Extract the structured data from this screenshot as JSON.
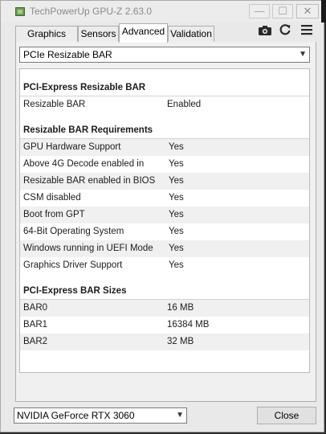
{
  "window": {
    "title": "TechPowerUp GPU-Z 2.63.0",
    "min_glyph": "—",
    "max_glyph": "☐",
    "close_glyph": "✕"
  },
  "tabs": [
    {
      "label": "Graphics Card",
      "active": false
    },
    {
      "label": "Sensors",
      "active": false
    },
    {
      "label": "Advanced",
      "active": true
    },
    {
      "label": "Validation",
      "active": false
    }
  ],
  "toolbar": {
    "icons": [
      "camera-icon",
      "refresh-icon",
      "menu-icon"
    ]
  },
  "category_select": {
    "value": "PCIe Resizable BAR"
  },
  "sections": [
    {
      "title": "PCI-Express Resizable BAR",
      "rows": [
        {
          "label": "Resizable BAR",
          "value": "Enabled"
        }
      ]
    },
    {
      "title": "Resizable BAR Requirements",
      "rows": [
        {
          "label": "GPU Hardware Support",
          "value": "Yes"
        },
        {
          "label": "Above 4G Decode enabled in",
          "value": "Yes"
        },
        {
          "label": "Resizable BAR enabled in BIOS",
          "value": "Yes"
        },
        {
          "label": "CSM disabled",
          "value": "Yes"
        },
        {
          "label": "Boot from GPT",
          "value": "Yes"
        },
        {
          "label": "64-Bit Operating System",
          "value": "Yes"
        },
        {
          "label": "Windows running in UEFI Mode",
          "value": "Yes"
        },
        {
          "label": "Graphics Driver Support",
          "value": "Yes"
        }
      ]
    },
    {
      "title": "PCI-Express BAR Sizes",
      "rows": [
        {
          "label": "BAR0",
          "value": "16 MB"
        },
        {
          "label": "BAR1",
          "value": "16384 MB"
        },
        {
          "label": "BAR2",
          "value": "32 MB"
        }
      ]
    }
  ],
  "footer": {
    "gpu_select_value": "NVIDIA GeForce RTX 3060",
    "close_label": "Close"
  },
  "colors": {
    "app_icon": "#6c9a54",
    "row_shade": "#f0f0f0"
  }
}
